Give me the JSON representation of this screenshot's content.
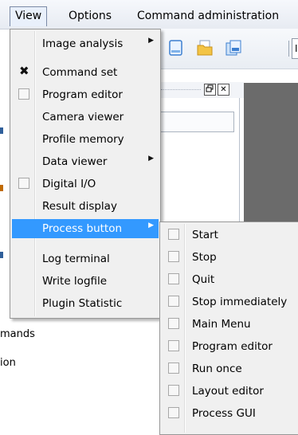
{
  "menubar": {
    "items": [
      "View",
      "Options",
      "Command administration"
    ]
  },
  "toolbar": {
    "edge_text": "I"
  },
  "background": {
    "texts": [
      "mands",
      "ion"
    ]
  },
  "view_menu": {
    "items": [
      {
        "label": "Image analysis",
        "submenu": true,
        "checkbox": false,
        "checked": false
      },
      {
        "label": "Command set",
        "submenu": false,
        "checkbox": false,
        "checked": true
      },
      {
        "label": "Program editor",
        "submenu": false,
        "checkbox": true,
        "checked": false
      },
      {
        "label": "Camera viewer",
        "submenu": false,
        "checkbox": false,
        "checked": false
      },
      {
        "label": "Profile memory",
        "submenu": false,
        "checkbox": false,
        "checked": false
      },
      {
        "label": "Data viewer",
        "submenu": true,
        "checkbox": false,
        "checked": false
      },
      {
        "label": "Digital I/O",
        "submenu": false,
        "checkbox": true,
        "checked": false
      },
      {
        "label": "Result display",
        "submenu": false,
        "checkbox": false,
        "checked": false
      },
      {
        "label": "Process button",
        "submenu": true,
        "checkbox": false,
        "checked": false,
        "highlighted": true
      },
      {
        "label": "Log terminal",
        "submenu": false,
        "checkbox": false,
        "checked": false
      },
      {
        "label": "Write logfile",
        "submenu": false,
        "checkbox": false,
        "checked": false
      },
      {
        "label": "Plugin Statistic",
        "submenu": false,
        "checkbox": false,
        "checked": false
      }
    ]
  },
  "process_submenu": {
    "items": [
      {
        "label": "Start",
        "checked": false
      },
      {
        "label": "Stop",
        "checked": false
      },
      {
        "label": "Quit",
        "checked": false
      },
      {
        "label": "Stop immediately",
        "checked": false
      },
      {
        "label": "Main Menu",
        "checked": false
      },
      {
        "label": "Program editor",
        "checked": false
      },
      {
        "label": "Run once",
        "checked": false
      },
      {
        "label": "Layout editor",
        "checked": false
      },
      {
        "label": "Process GUI",
        "checked": false
      }
    ]
  },
  "icons": {
    "check": "✖",
    "submenu_arrow": "▶",
    "restore": "🗗",
    "close": "✕"
  }
}
